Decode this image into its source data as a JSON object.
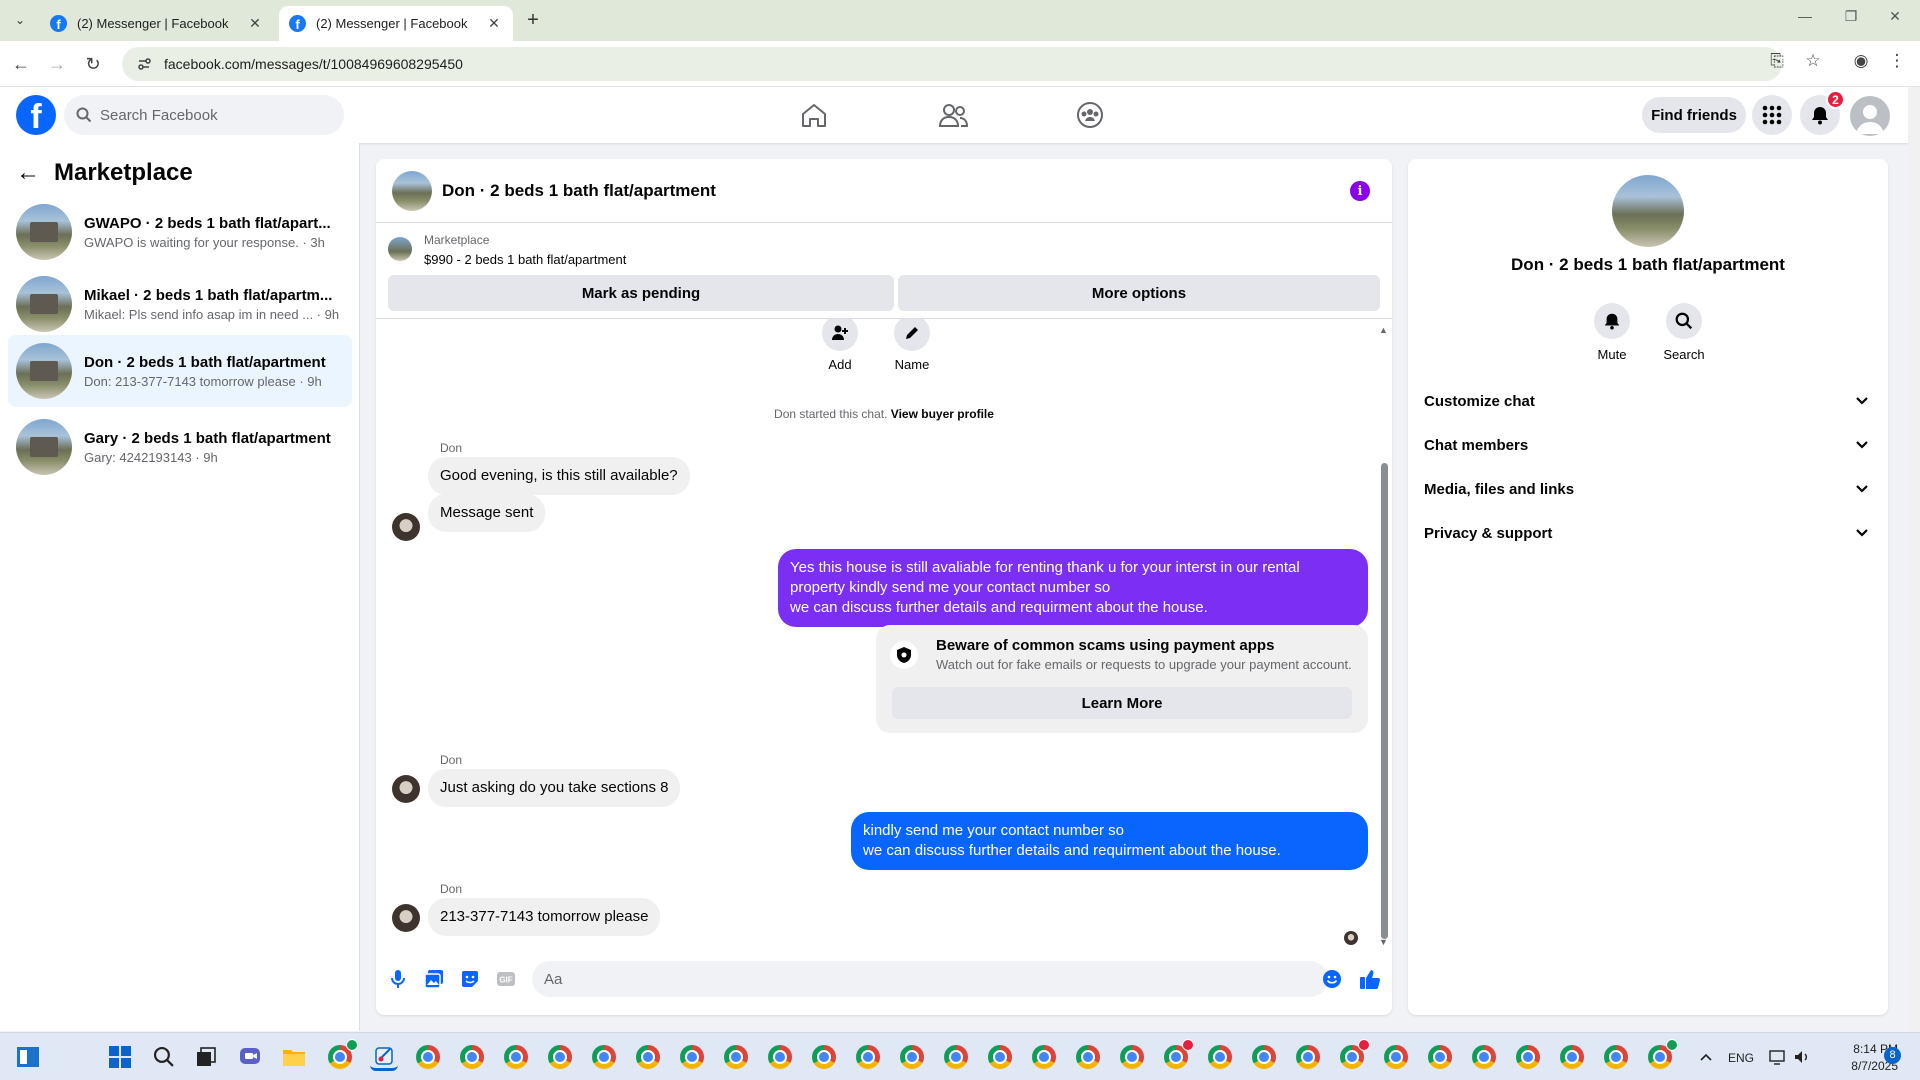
{
  "browser": {
    "tabs": [
      {
        "title": "(2) Messenger | Facebook",
        "active": false
      },
      {
        "title": "(2) Messenger | Facebook",
        "active": true
      }
    ],
    "url": "facebook.com/messages/t/10084969608295450"
  },
  "fb_header": {
    "search_placeholder": "Search Facebook",
    "find_friends_label": "Find friends",
    "notification_count": "2",
    "brand_color": "#0866ff"
  },
  "sidebar": {
    "title": "Marketplace",
    "conversations": [
      {
        "name": "GWAPO · 2 beds 1 bath flat/apart...",
        "snippet": "GWAPO is waiting for your response. · 3h",
        "selected": false
      },
      {
        "name": "Mikael · 2 beds 1 bath flat/apartm...",
        "snippet": "Mikael: Pls send info asap im in need ... · 9h",
        "selected": false
      },
      {
        "name": "Don · 2 beds 1 bath flat/apartment",
        "snippet": "Don: 213-377-7143 tomorrow please · 9h",
        "selected": true
      },
      {
        "name": "Gary · 2 beds 1 bath flat/apartment",
        "snippet": "Gary: 4242193143 · 9h",
        "selected": false
      }
    ]
  },
  "chat": {
    "title": "Don · 2 beds 1 bath flat/apartment",
    "listing": {
      "source": "Marketplace",
      "summary": "$990 - 2 beds 1 bath flat/apartment",
      "mark_pending_label": "Mark as pending",
      "more_options_label": "More options"
    },
    "actions": {
      "add_label": "Add",
      "name_label": "Name"
    },
    "started_text": "Don started this chat.",
    "view_buyer_profile": "View buyer profile",
    "messages": [
      {
        "sender": "Don",
        "text": "Good evening, is this still available?"
      },
      {
        "text": "Message sent"
      },
      {
        "out": true,
        "lines": [
          "Yes this house is still avaliable for renting thank u for your interst in our rental",
          "property kindly send me your contact number so",
          "we can discuss further details and requirment about the house."
        ]
      },
      {
        "sender": "Don",
        "text": "Just asking do you take sections 8"
      },
      {
        "out": true,
        "lines": [
          "kindly send me your contact number so",
          "we can discuss further details and requirment about the house."
        ]
      },
      {
        "sender": "Don",
        "text": "213-377-7143 tomorrow please"
      }
    ],
    "scam_notice": {
      "title": "Beware of common scams using payment apps",
      "body": "Watch out for fake emails or requests to upgrade your payment account.",
      "button": "Learn More"
    },
    "composer_placeholder": "Aa",
    "outgoing_color": "#0866ff",
    "outgoing_alt_color": "#7b2ff2"
  },
  "right_panel": {
    "name": "Don · 2 beds 1 bath flat/apartment",
    "mute_label": "Mute",
    "search_label": "Search",
    "sections": [
      "Customize chat",
      "Chat members",
      "Media, files and links",
      "Privacy & support"
    ]
  },
  "taskbar": {
    "language": "ENG",
    "time": "8:14 PM",
    "date": "8/7/2025",
    "notification_count": "8",
    "chrome_badge": "2"
  }
}
